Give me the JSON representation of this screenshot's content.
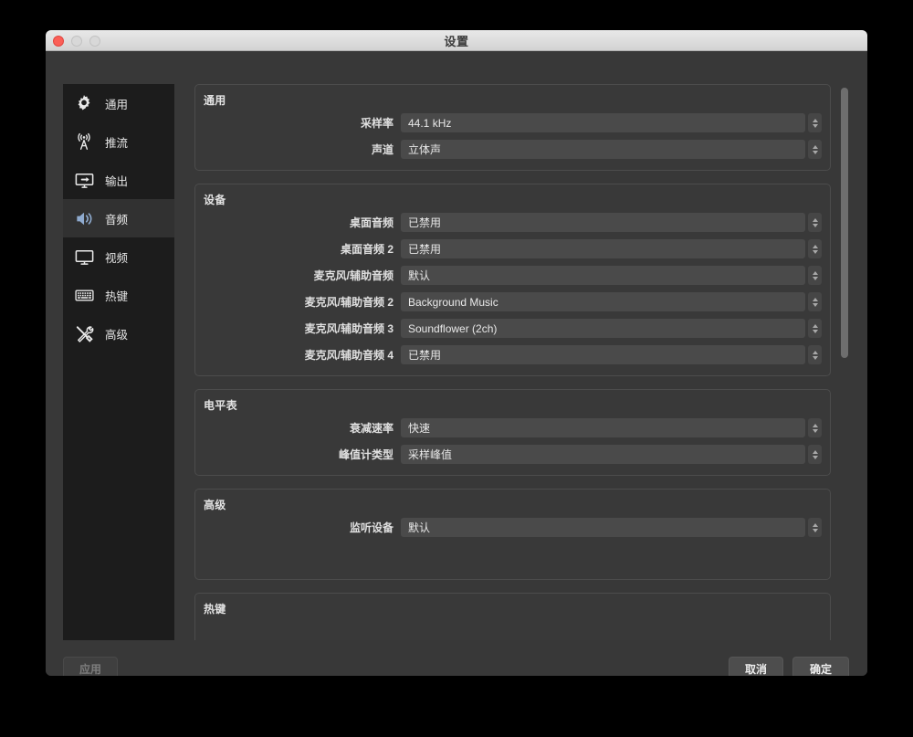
{
  "window": {
    "title": "设置",
    "traffic_lights": [
      "close",
      "minimize",
      "maximize"
    ]
  },
  "sidebar": {
    "items": [
      {
        "label": "通用",
        "icon": "gear-icon",
        "active": false
      },
      {
        "label": "推流",
        "icon": "broadcast-tower-icon",
        "active": false
      },
      {
        "label": "输出",
        "icon": "monitor-output-icon",
        "active": false
      },
      {
        "label": "音频",
        "icon": "speaker-icon",
        "active": true
      },
      {
        "label": "视频",
        "icon": "monitor-icon",
        "active": false
      },
      {
        "label": "热键",
        "icon": "keyboard-icon",
        "active": false
      },
      {
        "label": "高级",
        "icon": "tools-icon",
        "active": false
      }
    ],
    "active_color": "#8fabcf"
  },
  "main": {
    "groups": [
      {
        "title": "通用",
        "rows": [
          {
            "label": "采样率",
            "value": "44.1 kHz"
          },
          {
            "label": "声道",
            "value": "立体声"
          }
        ]
      },
      {
        "title": "设备",
        "rows": [
          {
            "label": "桌面音频",
            "value": "已禁用"
          },
          {
            "label": "桌面音频 2",
            "value": "已禁用"
          },
          {
            "label": "麦克风/辅助音频",
            "value": "默认"
          },
          {
            "label": "麦克风/辅助音频 2",
            "value": "Background Music"
          },
          {
            "label": "麦克风/辅助音频 3",
            "value": "Soundflower (2ch)"
          },
          {
            "label": "麦克风/辅助音频 4",
            "value": "已禁用"
          }
        ]
      },
      {
        "title": "电平表",
        "rows": [
          {
            "label": "衰减速率",
            "value": "快速"
          },
          {
            "label": "峰值计类型",
            "value": "采样峰值"
          }
        ]
      },
      {
        "title": "高级",
        "rows": [
          {
            "label": "监听设备",
            "value": "默认"
          }
        ]
      },
      {
        "title": "热键",
        "rows": []
      }
    ]
  },
  "footer": {
    "apply_label": "应用",
    "cancel_label": "取消",
    "ok_label": "确定"
  }
}
